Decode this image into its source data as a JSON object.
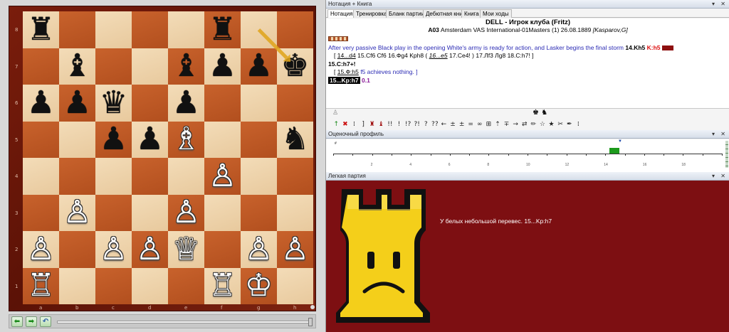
{
  "board": {
    "files": [
      "a",
      "b",
      "c",
      "d",
      "e",
      "f",
      "g",
      "h"
    ],
    "ranks": [
      "8",
      "7",
      "6",
      "5",
      "4",
      "3",
      "2",
      "1"
    ],
    "pieces": [
      {
        "sq": "a8",
        "glyph": "♜",
        "color": "black",
        "name": "black-rook-icon"
      },
      {
        "sq": "f8",
        "glyph": "♜",
        "color": "black",
        "name": "black-rook-icon"
      },
      {
        "sq": "b7",
        "glyph": "♝",
        "color": "black",
        "name": "black-bishop-icon"
      },
      {
        "sq": "e7",
        "glyph": "♝",
        "color": "black",
        "name": "black-bishop-icon"
      },
      {
        "sq": "f7",
        "glyph": "♟",
        "color": "black",
        "name": "black-pawn-icon"
      },
      {
        "sq": "g7",
        "glyph": "♟",
        "color": "black",
        "name": "black-pawn-icon"
      },
      {
        "sq": "h7",
        "glyph": "♚",
        "color": "black",
        "name": "black-king-icon"
      },
      {
        "sq": "a6",
        "glyph": "♟",
        "color": "black",
        "name": "black-pawn-icon"
      },
      {
        "sq": "b6",
        "glyph": "♟",
        "color": "black",
        "name": "black-pawn-icon"
      },
      {
        "sq": "c6",
        "glyph": "♛",
        "color": "black",
        "name": "black-queen-icon"
      },
      {
        "sq": "e6",
        "glyph": "♟",
        "color": "black",
        "name": "black-pawn-icon"
      },
      {
        "sq": "c5",
        "glyph": "♟",
        "color": "black",
        "name": "black-pawn-icon"
      },
      {
        "sq": "d5",
        "glyph": "♟",
        "color": "black",
        "name": "black-pawn-icon"
      },
      {
        "sq": "e5",
        "glyph": "♗",
        "color": "white",
        "name": "white-bishop-icon"
      },
      {
        "sq": "h5",
        "glyph": "♞",
        "color": "black",
        "name": "black-knight-icon"
      },
      {
        "sq": "f4",
        "glyph": "♙",
        "color": "white",
        "name": "white-pawn-icon"
      },
      {
        "sq": "b3",
        "glyph": "♙",
        "color": "white",
        "name": "white-pawn-icon"
      },
      {
        "sq": "e3",
        "glyph": "♙",
        "color": "white",
        "name": "white-pawn-icon"
      },
      {
        "sq": "a2",
        "glyph": "♙",
        "color": "white",
        "name": "white-pawn-icon"
      },
      {
        "sq": "c2",
        "glyph": "♙",
        "color": "white",
        "name": "white-pawn-icon"
      },
      {
        "sq": "d2",
        "glyph": "♙",
        "color": "white",
        "name": "white-pawn-icon"
      },
      {
        "sq": "e2",
        "glyph": "♕",
        "color": "white",
        "name": "white-queen-icon"
      },
      {
        "sq": "g2",
        "glyph": "♙",
        "color": "white",
        "name": "white-pawn-icon"
      },
      {
        "sq": "h2",
        "glyph": "♙",
        "color": "white",
        "name": "white-pawn-icon"
      },
      {
        "sq": "a1",
        "glyph": "♖",
        "color": "white",
        "name": "white-rook-icon"
      },
      {
        "sq": "f1",
        "glyph": "♖",
        "color": "white",
        "name": "white-rook-icon"
      },
      {
        "sq": "g1",
        "glyph": "♔",
        "color": "white",
        "name": "white-king-icon"
      }
    ],
    "last_move_arrow": {
      "from": "g8",
      "to": "h7",
      "color": "#e0a41a"
    }
  },
  "nav": {
    "back": "⬅",
    "forward": "➡",
    "undo": "↶"
  },
  "pane_titles": {
    "notation": "Нотация + Книга",
    "eval": "Оценочный профиль",
    "easy": "Легкая партия",
    "controls": "▾ ✕"
  },
  "tabs": [
    "Нотация",
    "Тренировка",
    "Бланк партии",
    "Дебютная книга",
    "Книга",
    "Мои ходы"
  ],
  "game": {
    "title": "DELL - Игрок клуба (Fritz)",
    "eco": "A03",
    "info": "Amsterdam VAS International-01Masters (1) 26.08.1889",
    "annotator": "[Kasparov,G]"
  },
  "notation": {
    "comment1": "After very passive Black play in the opening White's army is ready for action, and Lasker begins the final storm",
    "move14": "14.Kh5",
    "move14_alt": "K:h5",
    "line2_open": "[",
    "var1_u": "14...d4",
    "var1_rest": "15.Cf6  Cf6  16.Фg4  Kph8  (",
    "var1_sub_u": "16...e5",
    "var1_sub_rest": "17.Ce4! )  17.Лf3  Лg8  18.C:h7! ]",
    "move15": "15.C:h7+!",
    "line4_open": "[",
    "var2_u": "15.Ф:h5",
    "var2_rest": "f5 achieves nothing. ]",
    "current_move": "15...Kp:h7",
    "current_eval": "0.1"
  },
  "symbols_row1_left": "♙",
  "symbols_row1_right": "♚ ♞",
  "symbols": [
    "↑",
    "✖",
    "⁞",
    "]",
    "♜",
    "♝",
    "!!",
    "!",
    "!?",
    "?!",
    "?",
    "??",
    "←",
    "±",
    "±",
    "=",
    "∞",
    "⊞",
    "⇡",
    "∓",
    "→",
    "⇄",
    "✏",
    "☆",
    "★",
    "✂",
    "✒",
    "⁞"
  ],
  "eval_profile": {
    "ticks": [
      "2",
      "4",
      "6",
      "8",
      "10",
      "12",
      "14",
      "16",
      "18"
    ],
    "hash": "#",
    "marker": "▼",
    "current_move_index": 15,
    "current_eval": 0.1
  },
  "easy": {
    "message": "У белых небольшой перевес.  15...Kp:h7"
  }
}
